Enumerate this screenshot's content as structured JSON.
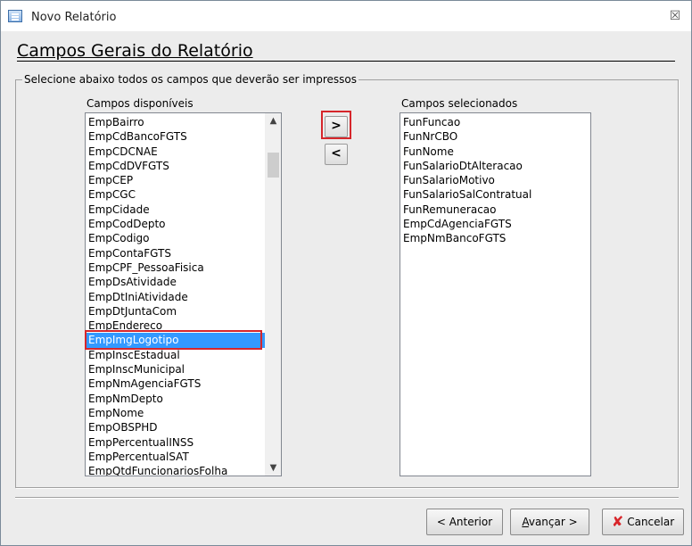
{
  "window": {
    "title": "Novo Relatório",
    "close_glyph": "☒"
  },
  "page": {
    "heading": "Campos Gerais do Relatório"
  },
  "group": {
    "legend": "Selecione abaixo todos os campos que deverão ser impressos"
  },
  "available": {
    "label": "Campos disponíveis",
    "items": [
      "EmpBairro",
      "EmpCdBancoFGTS",
      "EmpCDCNAE",
      "EmpCdDVFGTS",
      "EmpCEP",
      "EmpCGC",
      "EmpCidade",
      "EmpCodDepto",
      "EmpCodigo",
      "EmpContaFGTS",
      "EmpCPF_PessoaFisica",
      "EmpDsAtividade",
      "EmpDtIniAtividade",
      "EmpDtJuntaCom",
      "EmpEndereco",
      "EmpImgLogotipo",
      "EmpInscEstadual",
      "EmpInscMunicipal",
      "EmpNmAgenciaFGTS",
      "EmpNmDepto",
      "EmpNome",
      "EmpOBSPHD",
      "EmpPercentualINSS",
      "EmpPercentualSAT",
      "EmpQtdFuncionariosFolha"
    ],
    "selected_item": "EmpImgLogotipo",
    "scroll_up_glyph": "▲",
    "scroll_down_glyph": "▼"
  },
  "selected": {
    "label": "Campos selecionados",
    "items": [
      "FunFuncao",
      "FunNrCBO",
      "FunNome",
      "FunSalarioDtAlteracao",
      "FunSalarioMotivo",
      "FunSalarioSalContratual",
      "FunRemuneracao",
      "EmpCdAgenciaFGTS",
      "EmpNmBancoFGTS"
    ]
  },
  "move_buttons": {
    "add_label": ">",
    "remove_label": "<"
  },
  "footer": {
    "back_label": "< Anterior",
    "next_label": "Avançar >",
    "cancel_label": "Cancelar",
    "cancel_icon": "✘"
  },
  "colors": {
    "highlight": "#d6262b",
    "selection": "#3399ff",
    "cancel_icon": "#d8262b"
  }
}
